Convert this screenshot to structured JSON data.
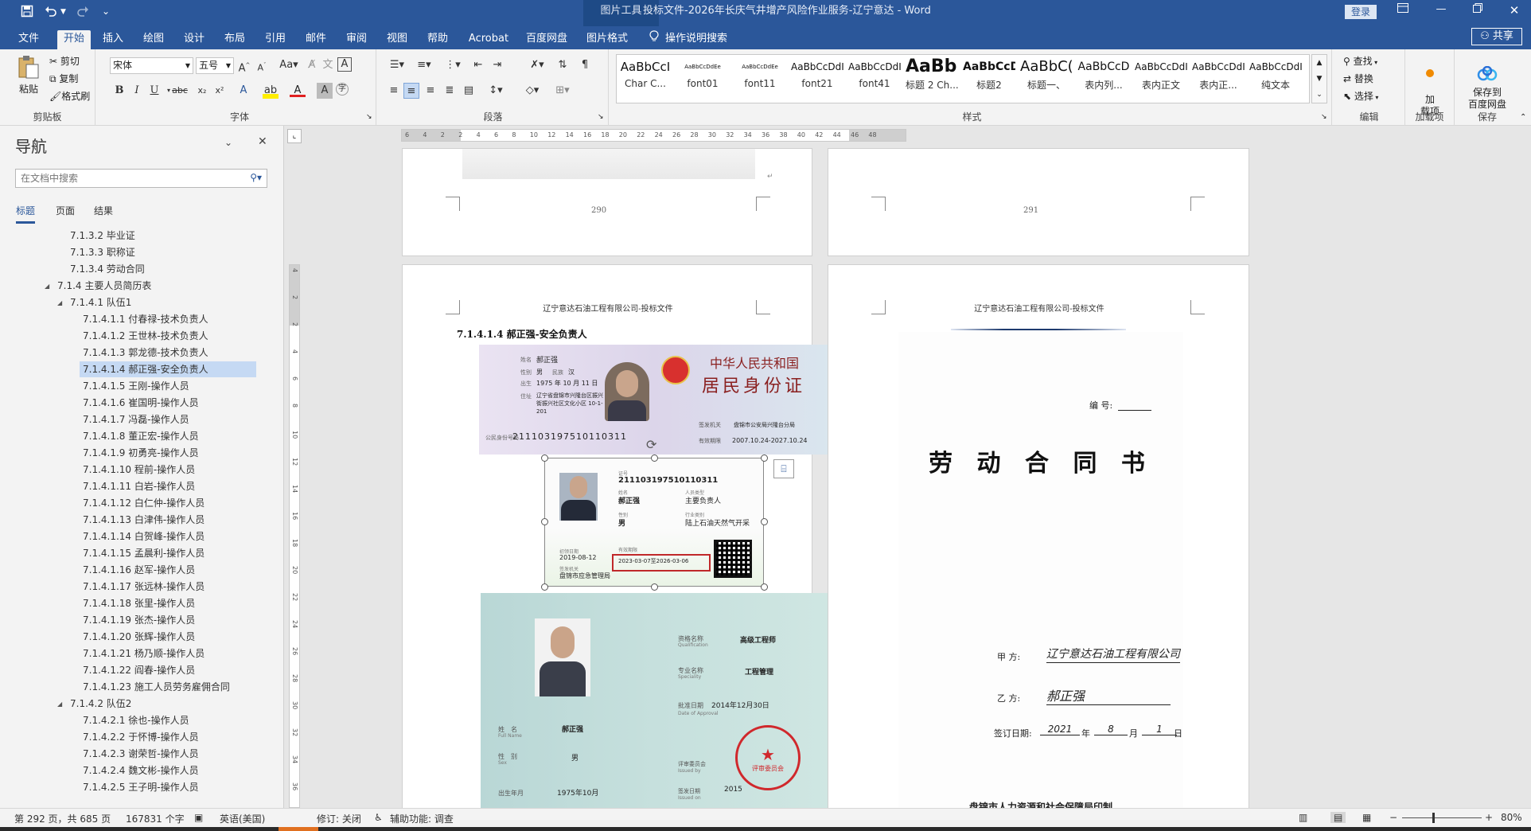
{
  "titlebar": {
    "context_tool": "图片工具",
    "doc_title": "投标文件-2026年长庆气井增产风险作业服务-辽宁意达  -  Word",
    "login_label": "登录",
    "buttons": [
      "save-icon",
      "undo-icon",
      "redo-icon"
    ]
  },
  "tabs": {
    "file": "文件",
    "home": "开始",
    "insert": "插入",
    "draw": "绘图",
    "design": "设计",
    "layout": "布局",
    "references": "引用",
    "mailings": "邮件",
    "review": "审阅",
    "view": "视图",
    "help": "帮助",
    "acrobat": "Acrobat",
    "baidu": "百度网盘",
    "picture_format": "图片格式",
    "tell_me": "操作说明搜索",
    "share": "共享"
  },
  "ribbon": {
    "clipboard": {
      "paste": "粘贴",
      "cut": "剪切",
      "copy": "复制",
      "format_painter": "格式刷",
      "label": "剪贴板"
    },
    "font": {
      "name": "宋体",
      "size": "五号",
      "label": "字体"
    },
    "paragraph": {
      "label": "段落"
    },
    "styles": {
      "label": "样式",
      "items": [
        {
          "preview": "AaBbCcI",
          "name": "Char C..."
        },
        {
          "preview": "AaBbCcDdEe",
          "name": "font01"
        },
        {
          "preview": "AaBbCcDdEe",
          "name": "font11"
        },
        {
          "preview": "AaBbCcDdI",
          "name": "font21"
        },
        {
          "preview": "AaBbCcDdI",
          "name": "font41"
        },
        {
          "preview": "AaBb(",
          "name": "标题 2 Ch..."
        },
        {
          "preview": "AaBbCcD",
          "name": "标题2"
        },
        {
          "preview": "AaBbC(",
          "name": "标题一、"
        },
        {
          "preview": "AaBbCcD",
          "name": "表内列..."
        },
        {
          "preview": "AaBbCcDdI",
          "name": "表内正文"
        },
        {
          "preview": "AaBbCcDdI",
          "name": "表内正..."
        },
        {
          "preview": "AaBbCcDdI",
          "name": "纯文本"
        }
      ]
    },
    "editing": {
      "find": "查找",
      "replace": "替换",
      "select": "选择",
      "label": "编辑"
    },
    "addins": {
      "button": "加\n载项",
      "label": "加载项"
    },
    "save_baidu": {
      "button": "保存到\n百度网盘",
      "label": "保存"
    }
  },
  "nav": {
    "title": "导航",
    "search_placeholder": "在文档中搜索",
    "tabs": [
      "标题",
      "页面",
      "结果"
    ],
    "items": [
      {
        "text": "7.1.3.2 毕业证",
        "level": 3
      },
      {
        "text": "7.1.3.3 职称证",
        "level": 3
      },
      {
        "text": "7.1.3.4 劳动合同",
        "level": 3
      },
      {
        "text": "7.1.4 主要人员简历表",
        "level": 2,
        "expanded": true
      },
      {
        "text": "7.1.4.1 队伍1",
        "level": 3,
        "expanded": true
      },
      {
        "text": "7.1.4.1.1 付春禄-技术负责人",
        "level": 4
      },
      {
        "text": "7.1.4.1.2 王世林-技术负责人",
        "level": 4
      },
      {
        "text": "7.1.4.1.3 郭龙德-技术负责人",
        "level": 4
      },
      {
        "text": "7.1.4.1.4 郝正强-安全负责人",
        "level": 4,
        "selected": true
      },
      {
        "text": "7.1.4.1.5 王刚-操作人员",
        "level": 4
      },
      {
        "text": "7.1.4.1.6 崔国明-操作人员",
        "level": 4
      },
      {
        "text": "7.1.4.1.7 冯磊-操作人员",
        "level": 4
      },
      {
        "text": "7.1.4.1.8 董正宏-操作人员",
        "level": 4
      },
      {
        "text": "7.1.4.1.9 初勇亮-操作人员",
        "level": 4
      },
      {
        "text": "7.1.4.1.10 程前-操作人员",
        "level": 4
      },
      {
        "text": "7.1.4.1.11 白岩-操作人员",
        "level": 4
      },
      {
        "text": "7.1.4.1.12 白仁仲-操作人员",
        "level": 4
      },
      {
        "text": "7.1.4.1.13 白津伟-操作人员",
        "level": 4
      },
      {
        "text": "7.1.4.1.14 白贺峰-操作人员",
        "level": 4
      },
      {
        "text": "7.1.4.1.15 孟晨利-操作人员",
        "level": 4
      },
      {
        "text": "7.1.4.1.16 赵军-操作人员",
        "level": 4
      },
      {
        "text": "7.1.4.1.17 张远林-操作人员",
        "level": 4
      },
      {
        "text": "7.1.4.1.18 张里-操作人员",
        "level": 4
      },
      {
        "text": "7.1.4.1.19 张杰-操作人员",
        "level": 4
      },
      {
        "text": "7.1.4.1.20 张辉-操作人员",
        "level": 4
      },
      {
        "text": "7.1.4.1.21 杨乃顺-操作人员",
        "level": 4
      },
      {
        "text": "7.1.4.1.22 阎春-操作人员",
        "level": 4
      },
      {
        "text": "7.1.4.1.23 施工人员劳务雇佣合同",
        "level": 4
      },
      {
        "text": "7.1.4.2 队伍2",
        "level": 3,
        "expanded": true
      },
      {
        "text": "7.1.4.2.1 徐也-操作人员",
        "level": 4
      },
      {
        "text": "7.1.4.2.2 于怀博-操作人员",
        "level": 4
      },
      {
        "text": "7.1.4.2.3 谢荣哲-操作人员",
        "level": 4
      },
      {
        "text": "7.1.4.2.4 魏文彬-操作人员",
        "level": 4
      },
      {
        "text": "7.1.4.2.5 王子明-操作人员",
        "level": 4
      }
    ]
  },
  "ruler": {
    "h_ticks": [
      "6",
      "4",
      "2",
      "2",
      "4",
      "6",
      "8",
      "10",
      "12",
      "14",
      "16",
      "18",
      "20",
      "22",
      "24",
      "26",
      "28",
      "30",
      "32",
      "34",
      "36",
      "38",
      "40",
      "42",
      "44",
      "46",
      "48"
    ],
    "v_ticks": [
      "4",
      "2",
      "2",
      "4",
      "6",
      "8",
      "10",
      "12",
      "14",
      "16",
      "18",
      "20",
      "22",
      "24",
      "26",
      "28",
      "30",
      "32",
      "34",
      "36"
    ]
  },
  "pages": {
    "p290_number": "290",
    "p291_number": "291",
    "header": "辽宁意达石油工程有限公司-投标文件",
    "heading": "7.1.4.1.4  郝正强-安全负责人",
    "id_card": {
      "title1": "中华人民共和国",
      "title2": "居民身份证",
      "name_label": "姓名",
      "name": "郝正强",
      "sex_label": "性别",
      "sex": "男",
      "ethnic_label": "民族",
      "ethnic": "汉",
      "birth_label": "出生",
      "birth": "1975 年 10 月 11 日",
      "address_label": "住址",
      "address": "辽宁省盘锦市兴隆台区振兴街振兴社区文化小区 10-1-201",
      "id_label": "公民身份号码",
      "id_number": "211103197510110311",
      "authority_label": "签发机关",
      "authority": "盘锦市公安局兴隆台分局",
      "valid_label": "有效期限",
      "valid": "2007.10.24-2027.10.24"
    },
    "safety_cert": {
      "cert_no_label": "证号",
      "cert_no": "211103197510110311",
      "name_label": "姓名",
      "name": "郝正强",
      "type_label": "人员类型",
      "type": "主要负责人",
      "sex_label": "性别",
      "sex": "男",
      "industry_label": "行业类别",
      "industry": "陆上石油天然气开采",
      "first_label": "初领日期",
      "first_date": "2019-08-12",
      "validity_label": "有效期限",
      "validity": "2023-03-07至2026-03-06",
      "issuer_label": "签发机关",
      "issuer": "盘锦市应急管理局"
    },
    "title_cert": {
      "qual_label": "资格名称",
      "qual_en": "Qualification",
      "qual": "高级工程师",
      "spec_label": "专业名称",
      "spec_en": "Speciality",
      "spec": "工程管理",
      "approval_label": "批准日期",
      "approval_en": "Date of Approval",
      "approval": "2014年12月30日",
      "name_label": "姓　名",
      "name_en": "Full Name",
      "name": "郝正强",
      "sex_label": "性　别",
      "sex_en": "Sex",
      "sex": "男",
      "birth_label": "出生年月",
      "birth": "1975年10月",
      "issued_label": "评审委员会",
      "issued_en": "Issued by",
      "issue_date_label": "签发日期",
      "issue_date_en": "Issued on",
      "issue_date": "2015",
      "stamp_text": "评审委员会"
    },
    "contract": {
      "number_label": "编  号:",
      "title": "劳 动 合 同 书",
      "party_a_label": "甲    方:",
      "party_a": "辽宁意达石油工程有限公司",
      "party_b_label": "乙    方:",
      "party_b": "郝正强",
      "sign_label": "签订日期:",
      "sign_year": "2021",
      "year_unit": "年",
      "sign_month": "8",
      "month_unit": "月",
      "sign_day": "1",
      "day_unit": "日",
      "printer": "盘锦市人力资源和社会保障局印制"
    }
  },
  "status": {
    "page": "第 292 页，共 685 页",
    "words": "167831 个字",
    "language": "英语(美国)",
    "track": "修订: 关闭",
    "accessibility": "辅助功能: 调查",
    "zoom": "80%"
  },
  "colors": {
    "word_blue": "#2b579a",
    "select_red": "#c0282a",
    "nav_selected": "#c5d9f3"
  }
}
